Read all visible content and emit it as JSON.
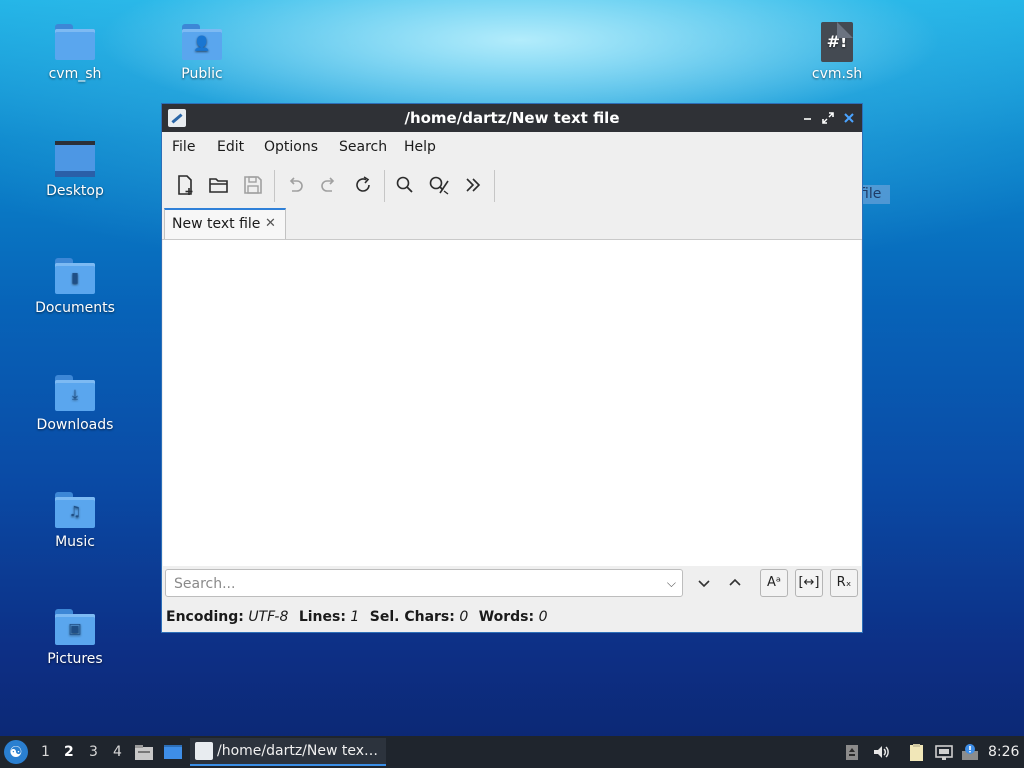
{
  "desktop": {
    "icons": [
      {
        "label": "cvm_sh",
        "icon": "folder-icon"
      },
      {
        "label": "Public",
        "icon": "public-folder-icon"
      },
      {
        "label": "cvm.sh",
        "icon": "shell-script-file-icon"
      },
      {
        "label": "Desktop",
        "icon": "desktop-folder-icon"
      },
      {
        "label": "Documents",
        "icon": "documents-folder-icon"
      },
      {
        "label": "Downloads",
        "icon": "downloads-folder-icon"
      },
      {
        "label": "Music",
        "icon": "music-folder-icon"
      },
      {
        "label": "Pictures",
        "icon": "pictures-folder-icon"
      }
    ],
    "partial_label": "file"
  },
  "window": {
    "title": "/home/dartz/New text file",
    "menu": [
      "File",
      "Edit",
      "Options",
      "Search",
      "Help"
    ],
    "toolbar": [
      "new-file-icon",
      "open-file-icon",
      "save-icon",
      "undo-icon",
      "redo-icon",
      "reload-icon",
      "find-icon",
      "replace-icon",
      "more-icon"
    ],
    "tabs": [
      {
        "label": "New text file",
        "active": true
      }
    ],
    "editor": {
      "content": ""
    },
    "findbar": {
      "placeholder": "Search...",
      "value": ""
    },
    "status": {
      "encoding_label": "Encoding:",
      "encoding": "UTF-8",
      "lines_label": "Lines:",
      "lines": "1",
      "sel_label": "Sel. Chars:",
      "sel": "0",
      "words_label": "Words:",
      "words": "0"
    }
  },
  "taskbar": {
    "workspaces": [
      "1",
      "2",
      "3",
      "4"
    ],
    "active_workspace": "2",
    "task_label": "/home/dartz/New tex…",
    "clock": "8:26"
  },
  "colors": {
    "accent": "#2f80d8",
    "titlebar": "#2f3136",
    "taskbar": "#1f252d"
  }
}
